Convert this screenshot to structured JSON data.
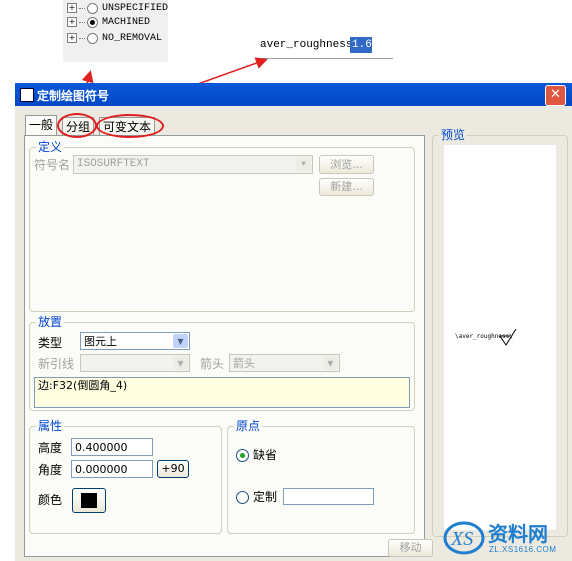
{
  "tree": {
    "items": [
      {
        "label": "UNSPECIFIED",
        "selected": false
      },
      {
        "label": "MACHINED",
        "selected": true
      },
      {
        "label": "NO_REMOVAL",
        "selected": false
      }
    ]
  },
  "param": {
    "name": "aver_roughness",
    "value": "1.6"
  },
  "dialog": {
    "title": "定制绘图符号",
    "close_glyph": "✕",
    "tabs": [
      "一般",
      "分组",
      "可变文本"
    ],
    "definition": {
      "legend": "定义",
      "symbol_name_label": "符号名",
      "symbol_name_value": "ISOSURFTEXT",
      "browse_label": "浏览...",
      "new_label": "新建..."
    },
    "placement": {
      "legend": "放置",
      "type_label": "类型",
      "type_value": "图元上",
      "leader_label": "新引线",
      "arrow_label": "箭头",
      "arrow_value": "箭头",
      "reference_text": "边:F32(倒圆角_4)"
    },
    "attributes": {
      "legend": "属性",
      "height_label": "高度",
      "height_value": "0.400000",
      "angle_label": "角度",
      "angle_value": "0.000000",
      "plus90_label": "+90",
      "color_label": "颜色",
      "color_value": "#000000"
    },
    "origin": {
      "legend": "原点",
      "default_label": "缺省",
      "custom_label": "定制",
      "selected": "default"
    },
    "preview": {
      "legend": "预览",
      "symbol_text": "\\aver_roughness\\"
    },
    "move_label": "移动"
  },
  "watermark": {
    "brand": "资料网",
    "url": "ZL.XS1616.COM"
  },
  "colors": {
    "title_bar": "#0a59d8",
    "legend": "#0046d5",
    "annotation": "#e02020"
  }
}
